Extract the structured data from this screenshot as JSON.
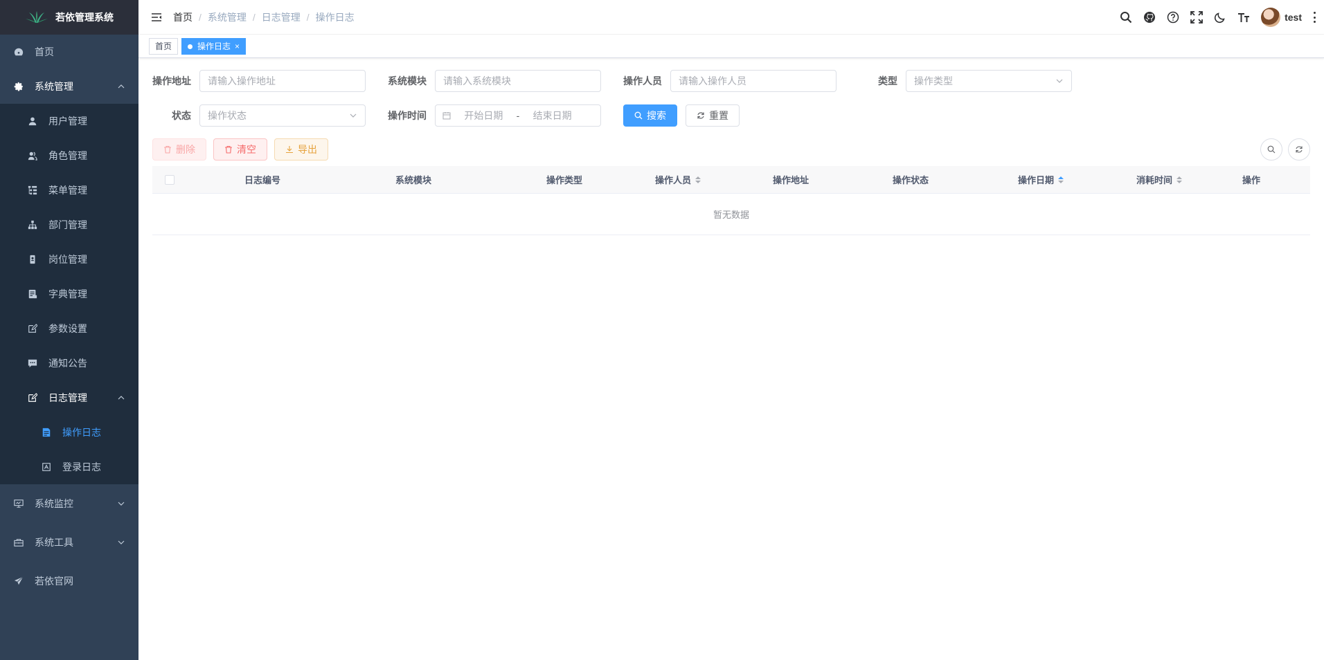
{
  "app": {
    "title": "若依管理系统"
  },
  "sidebar": {
    "items": [
      {
        "label": "首页",
        "icon": "dashboard-icon"
      },
      {
        "label": "系统管理",
        "icon": "gear-icon",
        "expanded": true,
        "children": [
          {
            "label": "用户管理",
            "icon": "user-icon"
          },
          {
            "label": "角色管理",
            "icon": "peoples-icon"
          },
          {
            "label": "菜单管理",
            "icon": "tree-table-icon"
          },
          {
            "label": "部门管理",
            "icon": "tree-icon"
          },
          {
            "label": "岗位管理",
            "icon": "post-icon"
          },
          {
            "label": "字典管理",
            "icon": "dict-icon"
          },
          {
            "label": "参数设置",
            "icon": "edit-icon"
          },
          {
            "label": "通知公告",
            "icon": "message-icon"
          },
          {
            "label": "日志管理",
            "icon": "log-icon",
            "expanded": true,
            "children": [
              {
                "label": "操作日志",
                "icon": "form-icon",
                "active": true
              },
              {
                "label": "登录日志",
                "icon": "logininfor-icon"
              }
            ]
          }
        ]
      },
      {
        "label": "系统监控",
        "icon": "monitor-icon"
      },
      {
        "label": "系统工具",
        "icon": "tool-icon"
      },
      {
        "label": "若依官网",
        "icon": "guide-icon"
      }
    ]
  },
  "breadcrumb": [
    "首页",
    "系统管理",
    "日志管理",
    "操作日志"
  ],
  "user": {
    "name": "test"
  },
  "tags": [
    {
      "label": "首页",
      "active": false
    },
    {
      "label": "操作日志",
      "active": true
    }
  ],
  "search": {
    "oper_ip": {
      "label": "操作地址",
      "placeholder": "请输入操作地址"
    },
    "title": {
      "label": "系统模块",
      "placeholder": "请输入系统模块"
    },
    "oper_name": {
      "label": "操作人员",
      "placeholder": "请输入操作人员"
    },
    "business_type": {
      "label": "类型",
      "placeholder": "操作类型"
    },
    "status": {
      "label": "状态",
      "placeholder": "操作状态"
    },
    "oper_time": {
      "label": "操作时间",
      "start_placeholder": "开始日期",
      "separator": "-",
      "end_placeholder": "结束日期"
    },
    "search_btn": "搜索",
    "reset_btn": "重置"
  },
  "toolbar": {
    "delete": "删除",
    "clean": "清空",
    "export": "导出"
  },
  "table": {
    "columns": [
      "日志编号",
      "系统模块",
      "操作类型",
      "操作人员",
      "操作地址",
      "操作状态",
      "操作日期",
      "消耗时间",
      "操作"
    ],
    "empty_text": "暂无数据"
  },
  "colors": {
    "sidebar_bg": "#304156",
    "submenu_bg": "#1f2d3d",
    "primary": "#409eff",
    "danger": "#f56c6c",
    "warning": "#e6a23c"
  }
}
